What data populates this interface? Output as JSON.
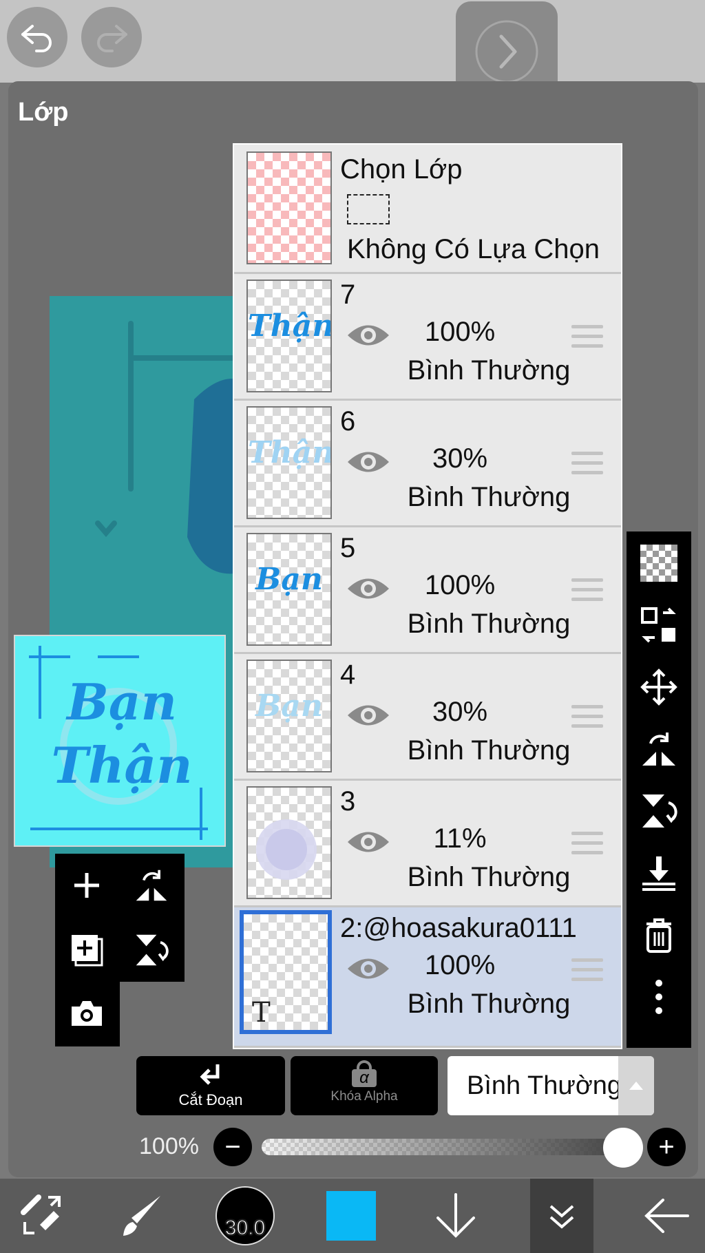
{
  "panel": {
    "title": "Lớp"
  },
  "selection": {
    "title": "Chọn Lớp",
    "status": "Không Có Lựa Chọn"
  },
  "layers": [
    {
      "name": "7",
      "opacity": "100%",
      "blend": "Bình Thường",
      "thumb_text": "Thận"
    },
    {
      "name": "6",
      "opacity": "30%",
      "blend": "Bình Thường",
      "thumb_text": "Thận"
    },
    {
      "name": "5",
      "opacity": "100%",
      "blend": "Bình Thường",
      "thumb_text": "Bạn"
    },
    {
      "name": "4",
      "opacity": "30%",
      "blend": "Bình Thường",
      "thumb_text": "Bạn"
    },
    {
      "name": "3",
      "opacity": "11%",
      "blend": "Bình Thường",
      "thumb_text": ""
    },
    {
      "name": "2:@hoasakura0111",
      "opacity": "100%",
      "blend": "Bình Thường",
      "thumb_text": "T",
      "selected": true
    }
  ],
  "preview": {
    "line1": "Bạn",
    "line2": "Thận"
  },
  "buttons": {
    "clip": "Cắt Đoạn",
    "alpha_lock": "Khóa Alpha",
    "alpha_symbol": "α"
  },
  "blend_mode": {
    "value": "Bình Thường"
  },
  "opacity": {
    "label": "100%",
    "value": 1.0
  },
  "brush": {
    "size": "30.0"
  },
  "colors": {
    "current": "#0ab8f5",
    "accent": "#2f6fd6",
    "canvas": "#2f9a9e",
    "preview": "#5ef0f5"
  },
  "icons": [
    "undo-icon",
    "redo-icon",
    "forward-icon",
    "transparency-icon",
    "layer-transfer-icon",
    "move-icon",
    "flip-horizontal-icon",
    "flip-vertical-icon",
    "merge-down-icon",
    "trash-icon",
    "more-icon",
    "add-layer-icon",
    "add-special-layer-icon",
    "camera-icon",
    "transform-icon",
    "brush-icon",
    "arrow-down-icon",
    "layer-panel-icon",
    "back-arrow-icon"
  ]
}
